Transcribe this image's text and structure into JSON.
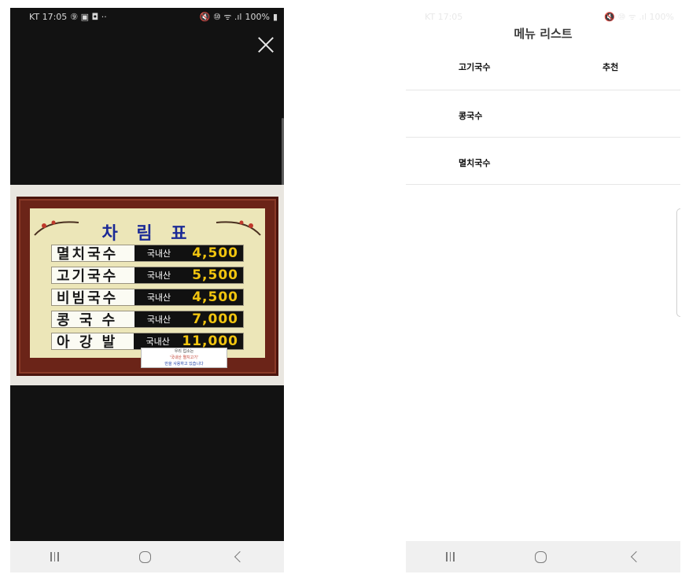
{
  "left_phone": {
    "status_bar": {
      "carrier_time": "KT 17:05",
      "left_icons": "⑨ ▣ ◘ ··",
      "right_icons": "🔇 ⑩ ᯤ .ıl",
      "battery": "100%"
    },
    "menu_board": {
      "title": "차 림 표",
      "items": [
        {
          "name": "멸치국수",
          "origin": "국내산",
          "price": "4,500"
        },
        {
          "name": "고기국수",
          "origin": "국내산",
          "price": "5,500"
        },
        {
          "name": "비빔국수",
          "origin": "국내산",
          "price": "4,500"
        },
        {
          "name": "콩 국 수",
          "origin": "국내산",
          "price": "7,000"
        },
        {
          "name": "아 강 발",
          "origin": "국내산",
          "price": "11,000"
        }
      ],
      "notice": {
        "line1": "우리 업소는",
        "line2": "'국내산 멸치고기'",
        "line3": "만을 사용하고 있습니다"
      }
    }
  },
  "right_phone": {
    "status_bar": {
      "carrier_time": "KT 17:05",
      "right_icons": "🔇 ⑩ ᯤ .ıl 100%"
    },
    "title": "메뉴 리스트",
    "items": [
      {
        "name": "고기국수",
        "tag": "추천"
      },
      {
        "name": "콩국수",
        "tag": ""
      },
      {
        "name": "멸치국수",
        "tag": ""
      }
    ]
  },
  "colors": {
    "price_text": "#f1c40f",
    "board_title": "#1b2a96",
    "frame": "#6b2418"
  }
}
